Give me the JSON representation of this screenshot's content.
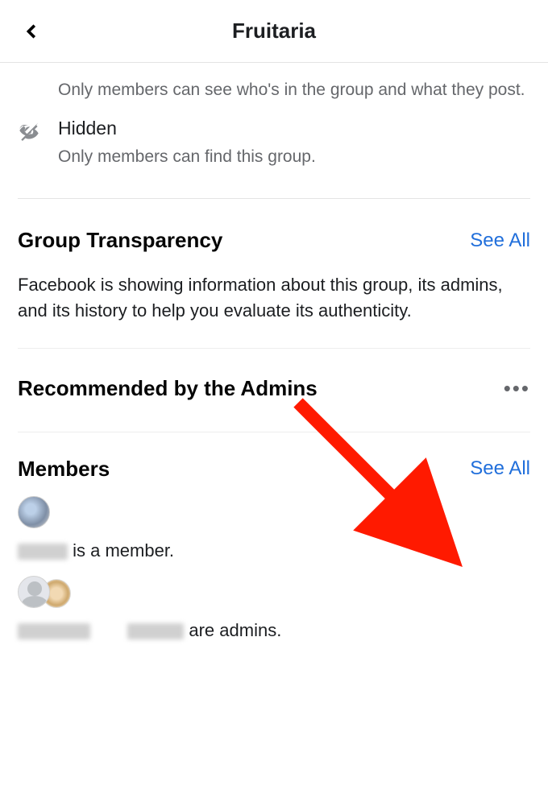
{
  "header": {
    "title": "Fruitaria"
  },
  "privacy": {
    "prev_desc": "Only members can see who's in the group and what they post.",
    "hidden_title": "Hidden",
    "hidden_desc": "Only members can find this group."
  },
  "transparency": {
    "title": "Group Transparency",
    "see_all": "See All",
    "body": "Facebook is showing information about this group, its admins, and its history to help you evaluate its authenticity."
  },
  "recommended": {
    "title": "Recommended by the Admins"
  },
  "members": {
    "title": "Members",
    "see_all": "See All",
    "line1_suffix": " is a member.",
    "line2_suffix": " are admins."
  },
  "icons": {
    "more": "•••"
  }
}
